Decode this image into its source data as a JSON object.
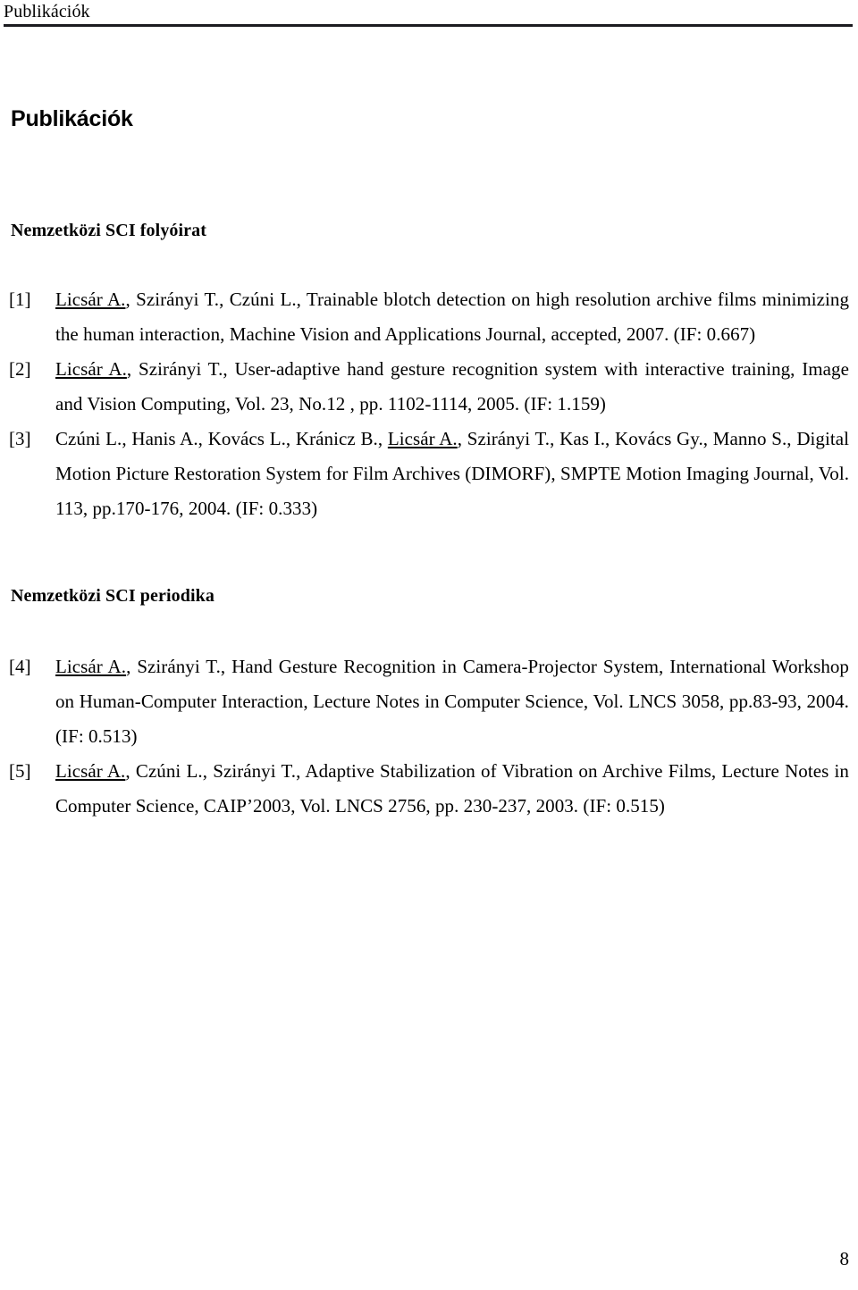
{
  "header": {
    "running_title": "Publikációk"
  },
  "document": {
    "title": "Publikációk",
    "page_number": "8"
  },
  "sections": [
    {
      "heading": "Nemzetközi SCI folyóirat",
      "references": [
        {
          "number": "[1]",
          "underlined_author": "Licsár A.",
          "rest": ", Szirányi T., Czúni L., Trainable blotch detection on high resolution archive films minimizing the human interaction, Machine Vision and Applications Journal, accepted, 2007. (IF: 0.667)"
        },
        {
          "number": "[2]",
          "underlined_author": "Licsár A.",
          "rest": ", Szirányi T., User-adaptive hand gesture recognition system with interactive training, Image and Vision Computing, Vol. 23, No.12 , pp. 1102-1114, 2005. (IF: 1.159)"
        },
        {
          "number": "[3]",
          "prefix": "Czúni L., Hanis A., Kovács L., Kránicz B., ",
          "underlined_author": "Licsár A.",
          "rest": ", Szirányi T., Kas I., Kovács Gy., Manno S., Digital Motion Picture Restoration System for Film Archives (DIMORF), SMPTE Motion Imaging Journal, Vol. 113, pp.170-176, 2004. (IF: 0.333)"
        }
      ]
    },
    {
      "heading": "Nemzetközi SCI periodika",
      "references": [
        {
          "number": "[4]",
          "underlined_author": "Licsár A.",
          "rest": ", Szirányi T., Hand Gesture Recognition in Camera-Projector System, International Workshop on Human-Computer Interaction, Lecture Notes in Computer Science, Vol. LNCS 3058, pp.83-93, 2004. (IF: 0.513)"
        },
        {
          "number": "[5]",
          "underlined_author": "Licsár A.",
          "rest": ", Czúni L., Szirányi T., Adaptive Stabilization of Vibration on Archive Films, Lecture Notes in Computer Science, CAIP’2003, Vol. LNCS 2756, pp. 230-237, 2003. (IF: 0.515)"
        }
      ]
    }
  ]
}
